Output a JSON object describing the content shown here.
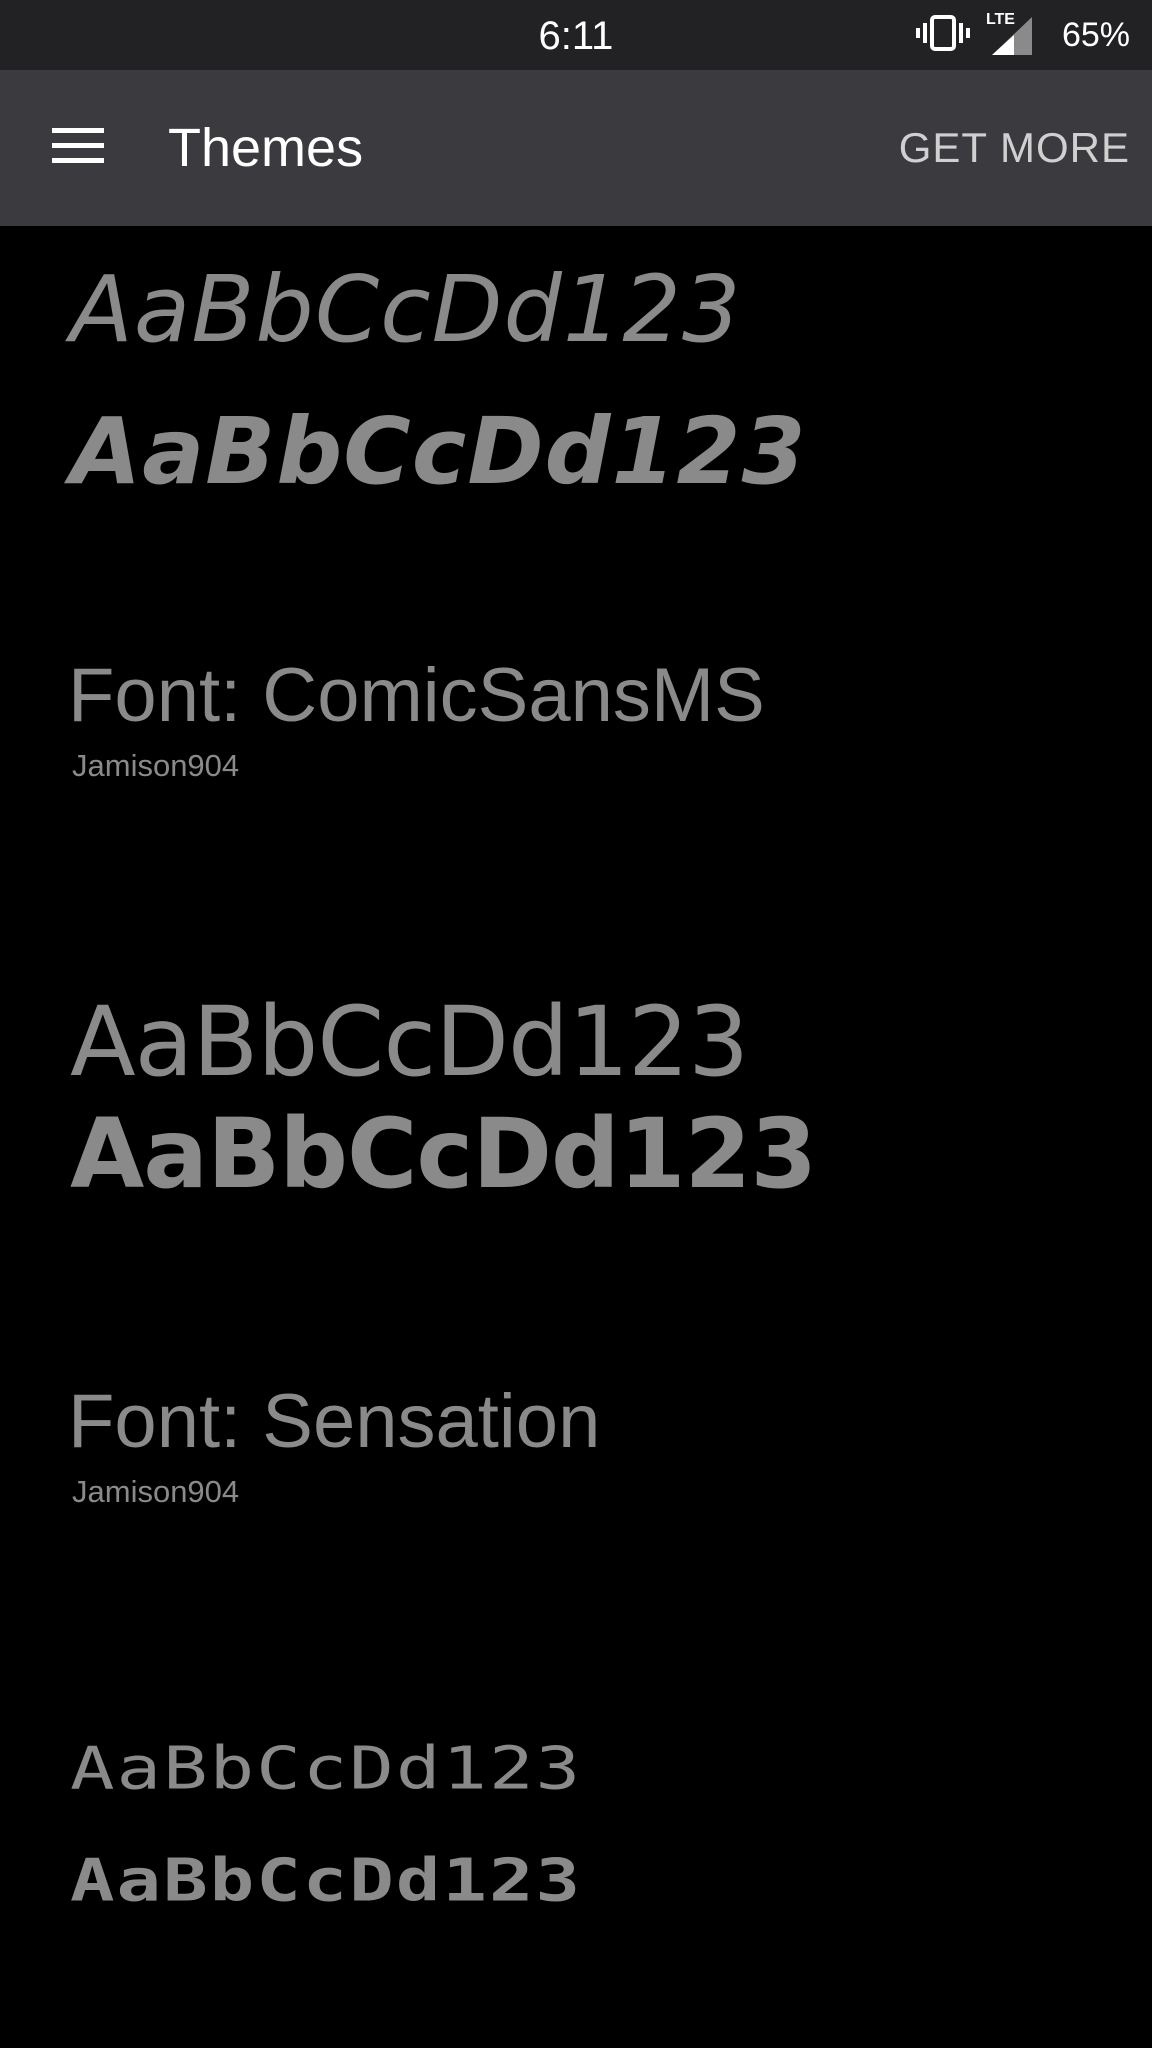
{
  "status_bar": {
    "time": "6:11",
    "network": "LTE",
    "battery": "65%"
  },
  "app_bar": {
    "title": "Themes",
    "action": "GET MORE"
  },
  "themes": [
    {
      "sample_regular": "AaBbCcDd123",
      "sample_bold": "AaBbCcDd123",
      "font_label": "Font: ComicSansMS",
      "author": "Jamison904"
    },
    {
      "sample_regular": "AaBbCcDd123",
      "sample_bold": "AaBbCcDd123",
      "font_label": "Font: Sensation",
      "author": "Jamison904"
    },
    {
      "sample_regular": "AaBbCcDd123",
      "sample_bold": "AaBbCcDd123"
    }
  ],
  "colors": {
    "status_bar_bg": "#222224",
    "app_bar_bg": "#3b3a3e",
    "content_bg": "#000000",
    "sample_text": "#8a8a8a"
  }
}
